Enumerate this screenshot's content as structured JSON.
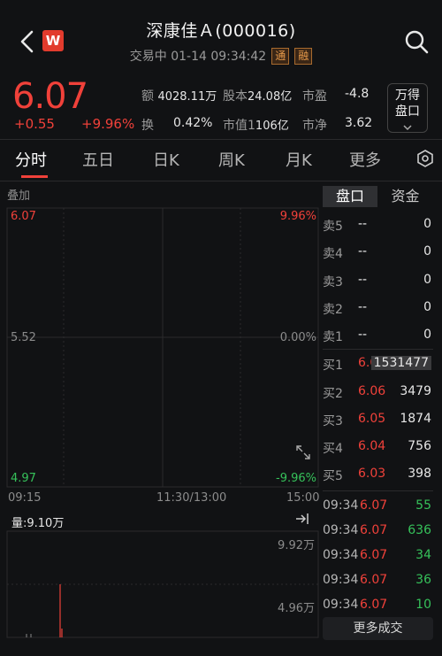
{
  "header": {
    "title": "深康佳Ａ(000016)",
    "status": "交易中 01-14 09:34:42",
    "tag1": "通",
    "tag2": "融",
    "logo": "W"
  },
  "quote": {
    "price": "6.07",
    "change": "+0.55",
    "change_pct": "+9.96%",
    "stats": [
      {
        "label": "额",
        "value": "4028.11万"
      },
      {
        "label": "股本",
        "value": "24.08亿"
      },
      {
        "label": "市盈",
        "value": "-4.8"
      },
      {
        "label": "换",
        "value": "0.42%"
      },
      {
        "label": "市值1",
        "value": "106亿"
      },
      {
        "label": "市净",
        "value": "3.62"
      }
    ],
    "wd_button": [
      "万得",
      "盘口"
    ]
  },
  "tabs": [
    "分时",
    "五日",
    "日K",
    "周K",
    "月K",
    "更多"
  ],
  "chart": {
    "overlay_label": "叠加",
    "y_left": [
      "6.07",
      "5.52",
      "4.97"
    ],
    "y_right": [
      "9.96%",
      "0.00%",
      "-9.96%"
    ],
    "x_labels": [
      "09:15",
      "11:30/13:00",
      "15:00"
    ],
    "volume_label": "量:9.10万",
    "vol_right": [
      "9.92万",
      "4.96万"
    ]
  },
  "orderbook": {
    "tabs": [
      "盘口",
      "资金"
    ],
    "asks": [
      {
        "label": "卖5",
        "price": "--",
        "vol": "0"
      },
      {
        "label": "卖4",
        "price": "--",
        "vol": "0"
      },
      {
        "label": "卖3",
        "price": "--",
        "vol": "0"
      },
      {
        "label": "卖2",
        "price": "--",
        "vol": "0"
      },
      {
        "label": "卖1",
        "price": "--",
        "vol": "0"
      }
    ],
    "bids": [
      {
        "label": "买1",
        "price": "6.07",
        "vol": "1531477"
      },
      {
        "label": "买2",
        "price": "6.06",
        "vol": "3479"
      },
      {
        "label": "买3",
        "price": "6.05",
        "vol": "1874"
      },
      {
        "label": "买4",
        "price": "6.04",
        "vol": "756"
      },
      {
        "label": "买5",
        "price": "6.03",
        "vol": "398"
      }
    ],
    "trades": [
      {
        "time": "09:34",
        "price": "6.07",
        "vol": "55",
        "dir": "green"
      },
      {
        "time": "09:34",
        "price": "6.07",
        "vol": "636",
        "dir": "green"
      },
      {
        "time": "09:34",
        "price": "6.07",
        "vol": "34",
        "dir": "green"
      },
      {
        "time": "09:34",
        "price": "6.07",
        "vol": "36",
        "dir": "green"
      },
      {
        "time": "09:34",
        "price": "6.07",
        "vol": "10",
        "dir": "green"
      }
    ],
    "more_label": "更多成交"
  },
  "colors": {
    "up": "#f0413a",
    "down": "#36c15a",
    "bg": "#111214"
  }
}
